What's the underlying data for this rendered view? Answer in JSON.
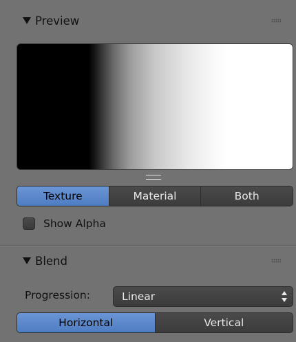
{
  "preview_panel": {
    "title": "Preview",
    "tabs": [
      {
        "label": "Texture",
        "active": true
      },
      {
        "label": "Material",
        "active": false
      },
      {
        "label": "Both",
        "active": false
      }
    ],
    "show_alpha": {
      "label": "Show Alpha",
      "checked": false
    }
  },
  "blend_panel": {
    "title": "Blend",
    "progression": {
      "label": "Progression:",
      "value": "Linear"
    },
    "direction": [
      {
        "label": "Horizontal",
        "active": true
      },
      {
        "label": "Vertical",
        "active": false
      }
    ]
  },
  "colors": {
    "background": "#727272",
    "accent": "#5b88cc",
    "button": "#424242"
  }
}
